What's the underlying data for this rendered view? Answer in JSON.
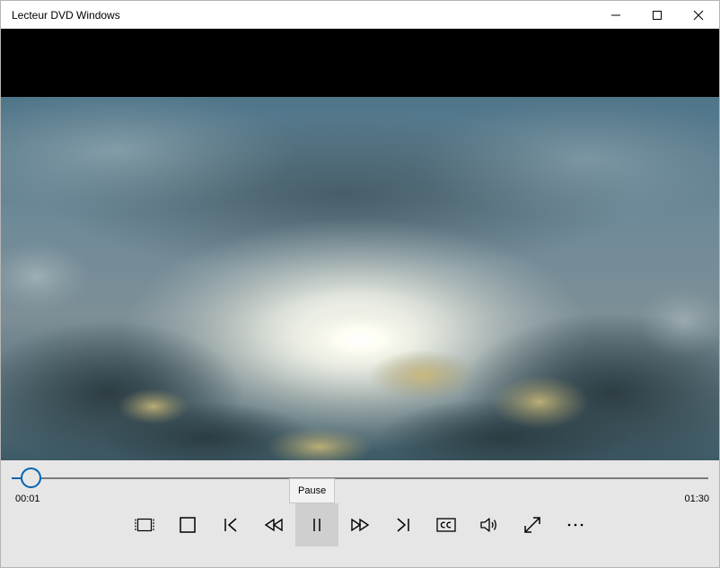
{
  "window": {
    "title": "Lecteur DVD Windows",
    "buttons": {
      "minimize": "minimize-icon",
      "maximize": "maximize-icon",
      "close": "close-icon"
    }
  },
  "player": {
    "current_time": "00:01",
    "total_time": "01:30",
    "progress": 0.011,
    "tooltip": "Pause"
  },
  "controls": [
    {
      "name": "aspect-ratio-button",
      "icon": "aspect-ratio-icon"
    },
    {
      "name": "stop-button",
      "icon": "stop-icon"
    },
    {
      "name": "previous-chapter-button",
      "icon": "skip-previous-icon"
    },
    {
      "name": "rewind-button",
      "icon": "rewind-icon"
    },
    {
      "name": "pause-button",
      "icon": "pause-icon",
      "active": true
    },
    {
      "name": "fast-forward-button",
      "icon": "fast-forward-icon"
    },
    {
      "name": "next-chapter-button",
      "icon": "skip-next-icon"
    },
    {
      "name": "subtitles-button",
      "icon": "closed-captions-icon"
    },
    {
      "name": "volume-button",
      "icon": "volume-icon"
    },
    {
      "name": "fullscreen-button",
      "icon": "fullscreen-icon"
    },
    {
      "name": "more-options-button",
      "icon": "more-icon"
    }
  ],
  "colors": {
    "accent": "#0063b1",
    "controls_bg": "#e6e6e6",
    "video_bg": "#000000"
  }
}
